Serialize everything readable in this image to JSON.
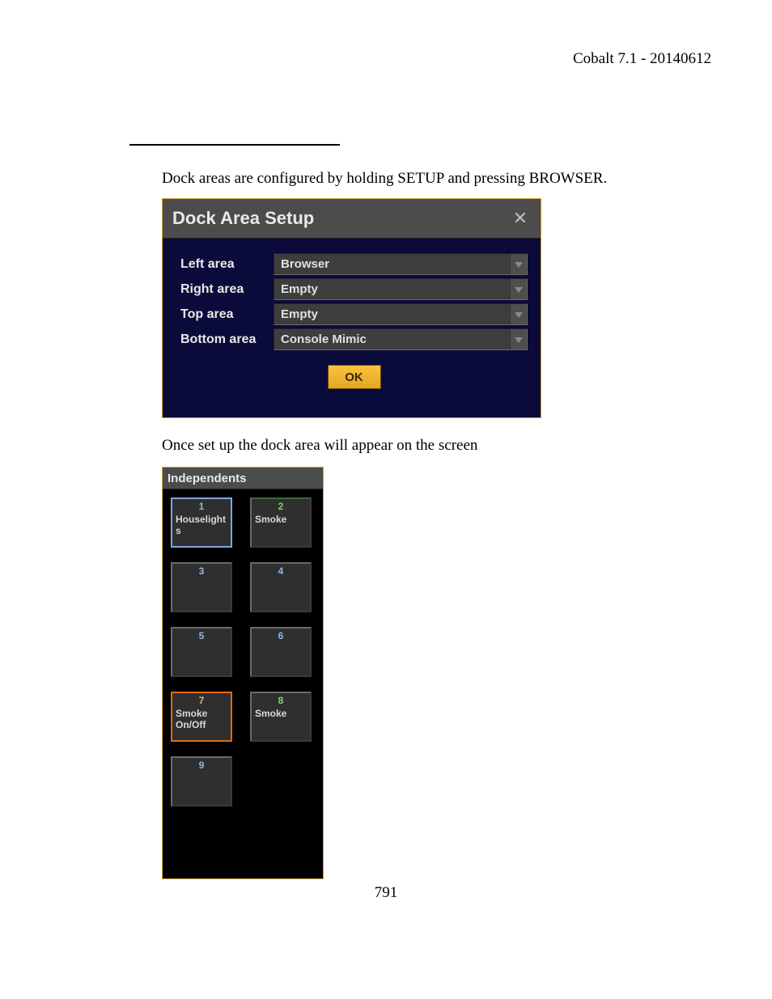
{
  "header": "Cobalt 7.1 - 20140612",
  "text": {
    "p1": "Dock areas are configured by holding SETUP and pressing BROWSER.",
    "p2": "Once set up the dock area will appear on the screen"
  },
  "page_number": "791",
  "dock": {
    "title": "Dock Area Setup",
    "rows": [
      {
        "label": "Left area",
        "value": "Browser"
      },
      {
        "label": "Right area",
        "value": "Empty"
      },
      {
        "label": "Top area",
        "value": "Empty"
      },
      {
        "label": "Bottom area",
        "value": "Console Mimic"
      }
    ],
    "ok": "OK"
  },
  "independents": {
    "title": "Independents",
    "tiles": [
      {
        "num": "1",
        "label": "Houselights",
        "variant": "sel-blue"
      },
      {
        "num": "2",
        "label": "Smoke",
        "variant": "sel-green"
      },
      {
        "num": "3",
        "label": "",
        "variant": ""
      },
      {
        "num": "4",
        "label": "",
        "variant": ""
      },
      {
        "num": "5",
        "label": "",
        "variant": ""
      },
      {
        "num": "6",
        "label": "",
        "variant": ""
      },
      {
        "num": "7",
        "label": "Smoke On/Off",
        "variant": "sel-orange"
      },
      {
        "num": "8",
        "label": "Smoke",
        "variant": "sel-green8"
      },
      {
        "num": "9",
        "label": "",
        "variant": ""
      }
    ]
  }
}
